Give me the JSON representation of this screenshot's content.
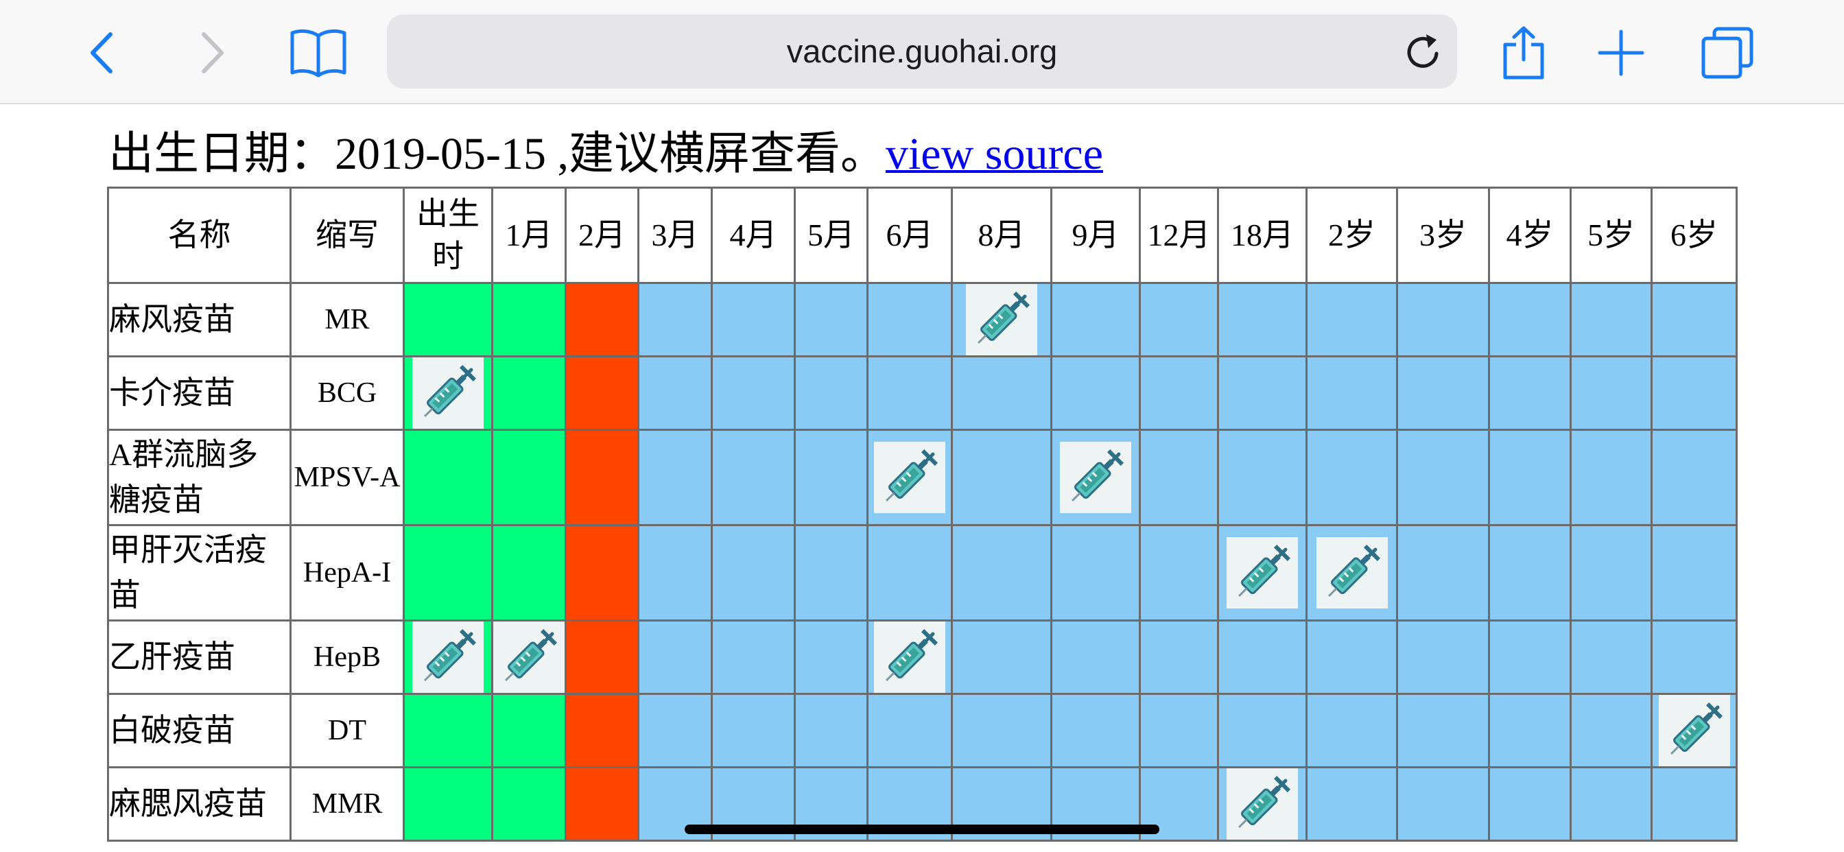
{
  "browser": {
    "url": "vaccine.guohai.org"
  },
  "page": {
    "heading_prefix": "出生日期：2019-05-15 ,建议横屏查看。",
    "source_link": "view source"
  },
  "table": {
    "headers": [
      "名称",
      "缩写",
      "出生时",
      "1月",
      "2月",
      "3月",
      "4月",
      "5月",
      "6月",
      "8月",
      "9月",
      "12月",
      "18月",
      "2岁",
      "3岁",
      "4岁",
      "5岁",
      "6岁"
    ],
    "rows": [
      {
        "name": "麻风疫苗",
        "abbr": "MR",
        "doses": [
          7
        ]
      },
      {
        "name": "卡介疫苗",
        "abbr": "BCG",
        "doses": [
          0
        ]
      },
      {
        "name": "A群流脑多糖疫苗",
        "abbr": "MPSV-A",
        "doses": [
          6,
          8
        ]
      },
      {
        "name": "甲肝灭活疫苗",
        "abbr": "HepA-I",
        "doses": [
          10,
          11
        ]
      },
      {
        "name": "乙肝疫苗",
        "abbr": "HepB",
        "doses": [
          0,
          1,
          6
        ]
      },
      {
        "name": "白破疫苗",
        "abbr": "DT",
        "doses": [
          15
        ]
      },
      {
        "name": "麻腮风疫苗",
        "abbr": "MMR",
        "doses": [
          10
        ]
      }
    ],
    "column_status": [
      "past",
      "past",
      "current",
      "upcoming",
      "upcoming",
      "upcoming",
      "upcoming",
      "upcoming",
      "upcoming",
      "upcoming",
      "upcoming",
      "upcoming",
      "upcoming",
      "upcoming",
      "upcoming",
      "upcoming"
    ],
    "colors": {
      "past": "#00ff7f",
      "current": "#ff4500",
      "upcoming": "#89cbf5"
    },
    "dose_icon": "syringe-icon"
  }
}
